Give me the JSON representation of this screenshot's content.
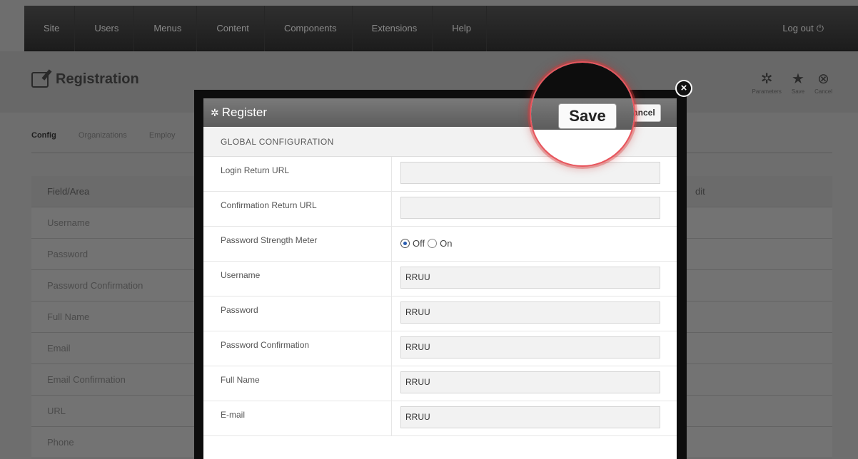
{
  "topnav": {
    "items": [
      "Site",
      "Users",
      "Menus",
      "Content",
      "Components",
      "Extensions",
      "Help"
    ],
    "logout": "Log out"
  },
  "page": {
    "title": "Registration",
    "tools": [
      {
        "icon": "gear-icon",
        "glyph": "✲",
        "label": "Parameters"
      },
      {
        "icon": "star-icon",
        "glyph": "★",
        "label": "Save"
      },
      {
        "icon": "cancel-icon",
        "glyph": "⊗",
        "label": "Cancel"
      }
    ],
    "subtabs": [
      "Config",
      "Organizations",
      "Employ"
    ],
    "field_header": "Field/Area",
    "fields": [
      "Username",
      "Password",
      "Password Confirmation",
      "Full Name",
      "Email",
      "Email Confirmation",
      "URL",
      "Phone"
    ],
    "right_header": "dit"
  },
  "modal": {
    "title": "Register",
    "save": "Save",
    "cancel": "Cancel",
    "section": "GLOBAL CONFIGURATION",
    "rows": [
      {
        "label": "Login Return URL",
        "type": "input",
        "value": ""
      },
      {
        "label": "Confirmation Return URL",
        "type": "input",
        "value": ""
      },
      {
        "label": "Password Strength Meter",
        "type": "radio",
        "options": [
          "Off",
          "On"
        ],
        "selected": "Off"
      },
      {
        "label": "Username",
        "type": "input",
        "value": "RRUU"
      },
      {
        "label": "Password",
        "type": "input",
        "value": "RRUU"
      },
      {
        "label": "Password Confirmation",
        "type": "input",
        "value": "RRUU"
      },
      {
        "label": "Full Name",
        "type": "input",
        "value": "RRUU"
      },
      {
        "label": "E-mail",
        "type": "input",
        "value": "RRUU"
      }
    ]
  },
  "colors": {
    "highlight": "#e8545c",
    "radio_selected": "#2a5db0"
  }
}
